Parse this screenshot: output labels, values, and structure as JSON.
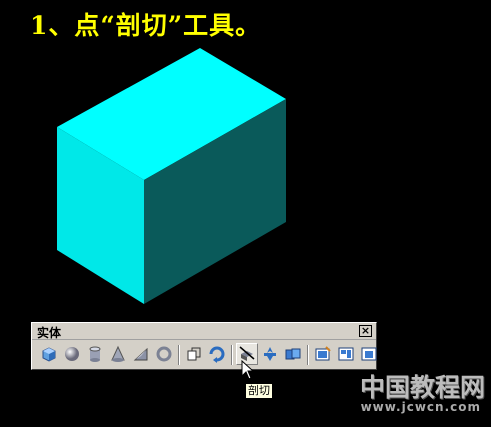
{
  "step": {
    "title": "1、点“剖切”工具。"
  },
  "toolbar": {
    "title": "实体",
    "close_label": "×",
    "buttons": [
      {
        "name": "box-icon"
      },
      {
        "name": "sphere-icon"
      },
      {
        "name": "cylinder-icon"
      },
      {
        "name": "cone-icon"
      },
      {
        "name": "wedge-icon"
      },
      {
        "name": "torus-icon"
      },
      {
        "name": "extrude-icon"
      },
      {
        "name": "revolve-icon"
      },
      {
        "name": "slice-icon"
      },
      {
        "name": "section-icon"
      },
      {
        "name": "interference-icon"
      },
      {
        "name": "setup-drawing-icon"
      },
      {
        "name": "setup-view-icon"
      },
      {
        "name": "setup-profile-icon"
      }
    ],
    "active_tool": "slice-icon"
  },
  "tooltip": {
    "text": "剖切"
  },
  "watermark": {
    "text": "中国教程网",
    "url": "www.jcwcn.com"
  },
  "colors": {
    "cube_top": "#00ffff",
    "cube_front": "#00e6e6",
    "cube_side": "#0a5a5a",
    "title": "#ffff00"
  }
}
